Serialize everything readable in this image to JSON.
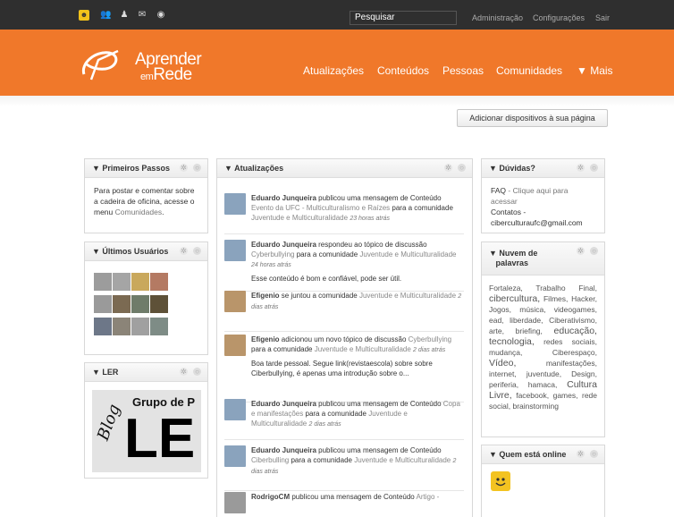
{
  "topbar": {
    "icons": [
      "smiley-icon",
      "friends-icon",
      "user-icon",
      "mail-icon",
      "globe-icon"
    ],
    "search_placeholder": "Pesquisar",
    "links": [
      "Administração",
      "Configurações",
      "Sair"
    ]
  },
  "header": {
    "logo": {
      "line1": "Aprender",
      "line2_small": "em",
      "line2_big": "Rede"
    },
    "nav": [
      "Atualizações",
      "Conteúdos",
      "Pessoas",
      "Comunidades",
      "▼ Mais"
    ]
  },
  "add_button": "Adicionar dispositivos à sua página",
  "left": {
    "primeiros": {
      "title": "▼ Primeiros Passos",
      "text1": "Para postar e comentar sobre a cadeira de oficina, acesse o menu ",
      "link": "Comunidades",
      "text2": "."
    },
    "ultimos": {
      "title": "▼ Últimos Usuários"
    },
    "ler": {
      "title": "▼ LER",
      "banner_line1": "Grupo de P",
      "banner_blog": "Blog",
      "banner_big": "LE"
    }
  },
  "middle": {
    "title": "▼ Atualizações",
    "items": [
      {
        "author": "Eduardo Junqueira",
        "action": " publicou uma mensagem de Conteúdo ",
        "target": "Evento da UFC - Multiculturalismo e Raízes",
        "mid": " para a comunidade ",
        "community": "Juventude e Multiculturalidade",
        "time": "23 horas atrás",
        "body": ""
      },
      {
        "author": "Eduardo Junqueira",
        "action": " respondeu ao tópico de discussão ",
        "target": "Cyberbullying",
        "mid": " para a comunidade ",
        "community": "Juventude e Multiculturalidade",
        "time": "24 horas atrás",
        "body": "Esse conteúdo é bom e confiável, pode ser útil."
      },
      {
        "author": "Efigenio",
        "action": " se juntou a comunidade ",
        "target": "",
        "mid": "",
        "community": "Juventude e Multiculturalidade",
        "time": "2 dias atrás",
        "body": ""
      },
      {
        "author": "Efigenio",
        "action": " adicionou um novo tópico de discussão ",
        "target": "Cyberbullying",
        "mid": " para a comunidade ",
        "community": "Juventude e Multiculturalidade",
        "time": "2 dias atrás",
        "body": "Boa tarde pessoal. Segue link(revistaescola) sobre sobre Ciberbullying, é apenas uma introdução sobre o..."
      },
      {
        "author": "Eduardo Junqueira",
        "action": " publicou uma mensagem de Conteúdo ",
        "target": "Copa e manifestações",
        "mid": " para a comunidade ",
        "community": "Juventude e Multiculturalidade",
        "time": "2 dias atrás",
        "body": ""
      },
      {
        "author": "Eduardo Junqueira",
        "action": " publicou uma mensagem de Conteúdo ",
        "target": "Ciberbulling",
        "mid": " para a comunidade ",
        "community": "Juventude e Multiculturalidade",
        "time": "2 dias atrás",
        "body": ""
      },
      {
        "author": "RodrigoCM",
        "action": " publicou uma mensagem de Conteúdo ",
        "target": "Artigo -",
        "mid": "",
        "community": "",
        "time": "",
        "body": ""
      }
    ]
  },
  "right": {
    "duvidas": {
      "title": "▼ Dúvidas?",
      "faq": "FAQ",
      "faq_text": " - Clique aqui para acessar",
      "contatos": "Contatos -",
      "email": "ciberculturaufc@gmail.com"
    },
    "nuvem": {
      "title_line1": "▼ Nuvem de",
      "title_line2": "palavras",
      "words": [
        {
          "w": "Fortaleza,",
          "big": false
        },
        {
          "w": "Trabalho Final,",
          "big": false
        },
        {
          "w": "cibercultura,",
          "big": true
        },
        {
          "w": "Filmes,",
          "big": false
        },
        {
          "w": "Hacker,",
          "big": false
        },
        {
          "w": "Jogos,",
          "big": false
        },
        {
          "w": "música,",
          "big": false
        },
        {
          "w": "videogames,",
          "big": false
        },
        {
          "w": "ead,",
          "big": false
        },
        {
          "w": "liberdade,",
          "big": false
        },
        {
          "w": "Ciberativismo,",
          "big": false
        },
        {
          "w": "arte,",
          "big": false
        },
        {
          "w": "briefing,",
          "big": false
        },
        {
          "w": "educação,",
          "big": true
        },
        {
          "w": "tecnologia,",
          "big": true
        },
        {
          "w": "redes sociais,",
          "big": false
        },
        {
          "w": "mudança,",
          "big": false
        },
        {
          "w": "Ciberespaço,",
          "big": false
        },
        {
          "w": "Vídeo,",
          "big": true
        },
        {
          "w": "manifestações,",
          "big": false
        },
        {
          "w": "internet,",
          "big": false
        },
        {
          "w": "juventude,",
          "big": false
        },
        {
          "w": "Design,",
          "big": false
        },
        {
          "w": "periferia,",
          "big": false
        },
        {
          "w": "hamaca,",
          "big": false
        },
        {
          "w": "Cultura Livre,",
          "big": true
        },
        {
          "w": "facebook,",
          "big": false
        },
        {
          "w": "games,",
          "big": false
        },
        {
          "w": "rede social,",
          "big": false
        },
        {
          "w": "brainstorming",
          "big": false
        }
      ]
    },
    "online": {
      "title": "▼ Quem está online"
    }
  }
}
